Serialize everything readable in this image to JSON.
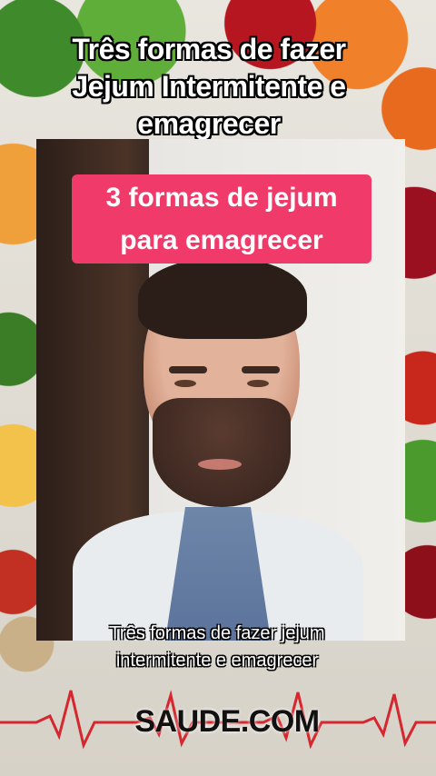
{
  "title": {
    "line1": "Três formas de fazer",
    "line2": "Jejum Intermitente e",
    "line3": "emagrecer"
  },
  "video": {
    "caption": {
      "line1": "3 formas de jejum",
      "line2": "para emagrecer"
    },
    "subtitle": {
      "line1": "Três formas de fazer jejum",
      "line2": "intermitente e emagrecer"
    }
  },
  "brand": "SAUDE.COM",
  "colors": {
    "caption_bg": "#f03b6a",
    "ecg_line": "#d6262e",
    "text_white": "#ffffff"
  }
}
